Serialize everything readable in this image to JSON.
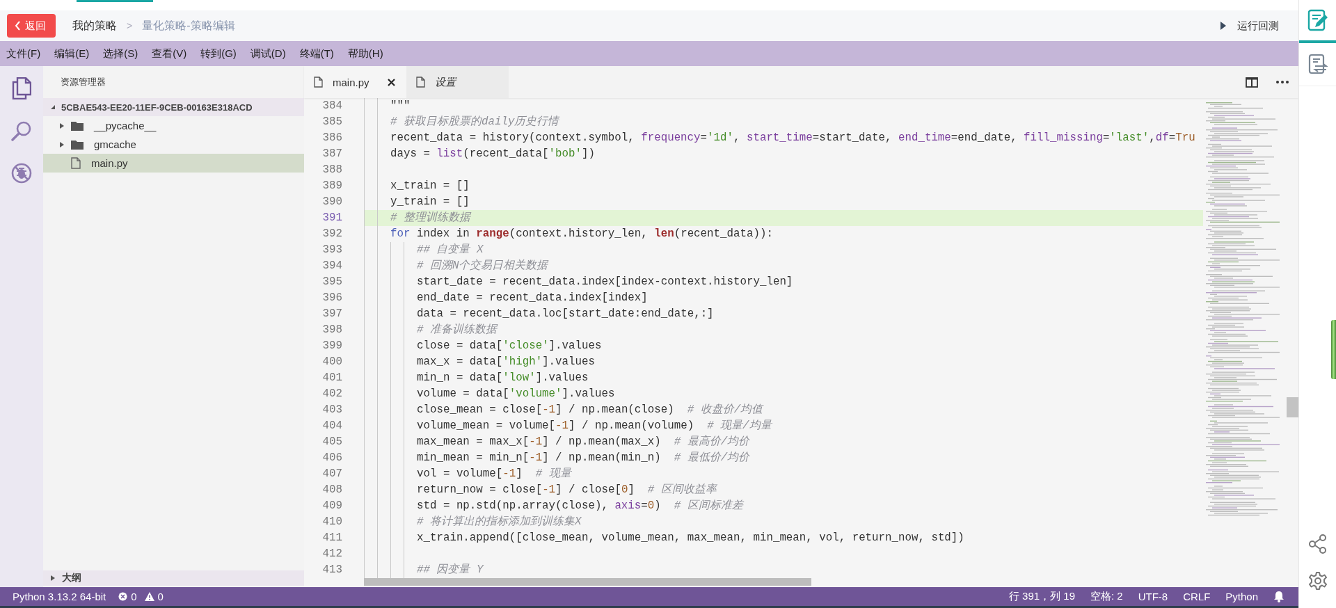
{
  "header": {
    "back_button": "返回",
    "breadcrumb": [
      {
        "label": "我的策略",
        "current": false
      },
      {
        "label": ">",
        "current": false
      },
      {
        "label": "量化策略-策略编辑",
        "current": true
      }
    ],
    "run_button": "运行回测"
  },
  "menu": [
    "文件(F)",
    "编辑(E)",
    "选择(S)",
    "查看(V)",
    "转到(G)",
    "调试(D)",
    "终端(T)",
    "帮助(H)"
  ],
  "explorer": {
    "title": "资源管理器",
    "root": {
      "label": "5CBAE543-EE20-11EF-9CEB-00163E318ACD",
      "expanded": true,
      "children": [
        {
          "label": "__pycache__",
          "kind": "folder",
          "expanded": false,
          "selected": false
        },
        {
          "label": "gmcache",
          "kind": "folder",
          "expanded": false,
          "selected": false
        },
        {
          "label": "main.py",
          "kind": "file",
          "selected": true
        }
      ]
    },
    "outline": {
      "label": "大纲",
      "expanded": false
    }
  },
  "editor": {
    "tabs": [
      {
        "label": "main.py",
        "selected": true,
        "preview": false
      },
      {
        "label": "设置",
        "selected": false,
        "preview": true
      }
    ],
    "lines": [
      {
        "number": "384",
        "current": false,
        "tokens": [
          {
            "kind": "plain",
            "text": "    \"\"\""
          }
        ]
      },
      {
        "number": "385",
        "current": false,
        "tokens": [
          {
            "kind": "comment",
            "text": "    # 获取目标股票的daily历史行情"
          }
        ]
      },
      {
        "number": "386",
        "current": false,
        "tokens": [
          {
            "kind": "plain",
            "text": "    recent_data = history(context.symbol, "
          },
          {
            "kind": "parameter",
            "text": "frequency"
          },
          {
            "kind": "plain",
            "text": "="
          },
          {
            "kind": "string",
            "text": "'1d'"
          },
          {
            "kind": "plain",
            "text": ", "
          },
          {
            "kind": "parameter",
            "text": "start_time"
          },
          {
            "kind": "plain",
            "text": "=start_date, "
          },
          {
            "kind": "parameter",
            "text": "end_time"
          },
          {
            "kind": "plain",
            "text": "=end_date, "
          },
          {
            "kind": "parameter",
            "text": "fill_missing"
          },
          {
            "kind": "plain",
            "text": "="
          },
          {
            "kind": "string",
            "text": "'last'"
          },
          {
            "kind": "plain",
            "text": ","
          },
          {
            "kind": "parameter",
            "text": "df"
          },
          {
            "kind": "plain",
            "text": "="
          },
          {
            "kind": "number",
            "text": "Tru"
          }
        ]
      },
      {
        "number": "387",
        "current": false,
        "tokens": [
          {
            "kind": "plain",
            "text": "    days = "
          },
          {
            "kind": "function",
            "text": "list"
          },
          {
            "kind": "plain",
            "text": "(recent_data["
          },
          {
            "kind": "string",
            "text": "'bob'"
          },
          {
            "kind": "plain",
            "text": "])"
          }
        ]
      },
      {
        "number": "388",
        "current": false
      },
      {
        "number": "389",
        "current": false,
        "tokens": [
          {
            "kind": "plain",
            "text": "    x_train = []"
          }
        ]
      },
      {
        "number": "390",
        "current": false,
        "tokens": [
          {
            "kind": "plain",
            "text": "    y_train = []"
          }
        ]
      },
      {
        "number": "391",
        "current": true,
        "tokens": [
          {
            "kind": "comment",
            "text": "    # 整理训练数据"
          }
        ]
      },
      {
        "number": "392",
        "current": false,
        "tokens": [
          {
            "kind": "keyword",
            "text": "    for"
          },
          {
            "kind": "plain",
            "text": " index in "
          },
          {
            "kind": "builtin",
            "text": "range"
          },
          {
            "kind": "plain",
            "text": "(context.history_len, "
          },
          {
            "kind": "builtin",
            "text": "len"
          },
          {
            "kind": "plain",
            "text": "(recent_data)):"
          }
        ]
      },
      {
        "number": "393",
        "current": false,
        "tokens": [
          {
            "kind": "comment",
            "text": "        ## 自变量 X"
          }
        ]
      },
      {
        "number": "394",
        "current": false,
        "tokens": [
          {
            "kind": "comment",
            "text": "        # 回溯N个交易日相关数据"
          }
        ]
      },
      {
        "number": "395",
        "current": false,
        "tokens": [
          {
            "kind": "plain",
            "text": "        start_date = recent_data.index[index-context.history_len]"
          }
        ]
      },
      {
        "number": "396",
        "current": false,
        "tokens": [
          {
            "kind": "plain",
            "text": "        end_date = recent_data.index[index]"
          }
        ]
      },
      {
        "number": "397",
        "current": false,
        "tokens": [
          {
            "kind": "plain",
            "text": "        data = recent_data.loc[start_date:end_date,:]"
          }
        ]
      },
      {
        "number": "398",
        "current": false,
        "tokens": [
          {
            "kind": "comment",
            "text": "        # 准备训练数据"
          }
        ]
      },
      {
        "number": "399",
        "current": false,
        "tokens": [
          {
            "kind": "plain",
            "text": "        close = data["
          },
          {
            "kind": "string",
            "text": "'close'"
          },
          {
            "kind": "plain",
            "text": "].values"
          }
        ]
      },
      {
        "number": "400",
        "current": false,
        "tokens": [
          {
            "kind": "plain",
            "text": "        max_x = data["
          },
          {
            "kind": "string",
            "text": "'high'"
          },
          {
            "kind": "plain",
            "text": "].values"
          }
        ]
      },
      {
        "number": "401",
        "current": false,
        "tokens": [
          {
            "kind": "plain",
            "text": "        min_n = data["
          },
          {
            "kind": "string",
            "text": "'low'"
          },
          {
            "kind": "plain",
            "text": "].values"
          }
        ]
      },
      {
        "number": "402",
        "current": false,
        "tokens": [
          {
            "kind": "plain",
            "text": "        volume = data["
          },
          {
            "kind": "string",
            "text": "'volume'"
          },
          {
            "kind": "plain",
            "text": "].values"
          }
        ]
      },
      {
        "number": "403",
        "current": false,
        "tokens": [
          {
            "kind": "plain",
            "text": "        close_mean = close["
          },
          {
            "kind": "number",
            "text": "-1"
          },
          {
            "kind": "plain",
            "text": "] / np.mean(close)  "
          },
          {
            "kind": "comment",
            "text": "# 收盘价/均值"
          }
        ]
      },
      {
        "number": "404",
        "current": false,
        "tokens": [
          {
            "kind": "plain",
            "text": "        volume_mean = volume["
          },
          {
            "kind": "number",
            "text": "-1"
          },
          {
            "kind": "plain",
            "text": "] / np.mean(volume)  "
          },
          {
            "kind": "comment",
            "text": "# 现量/均量"
          }
        ]
      },
      {
        "number": "405",
        "current": false,
        "tokens": [
          {
            "kind": "plain",
            "text": "        max_mean = max_x["
          },
          {
            "kind": "number",
            "text": "-1"
          },
          {
            "kind": "plain",
            "text": "] / np.mean(max_x)  "
          },
          {
            "kind": "comment",
            "text": "# 最高价/均价"
          }
        ]
      },
      {
        "number": "406",
        "current": false,
        "tokens": [
          {
            "kind": "plain",
            "text": "        min_mean = min_n["
          },
          {
            "kind": "number",
            "text": "-1"
          },
          {
            "kind": "plain",
            "text": "] / np.mean(min_n)  "
          },
          {
            "kind": "comment",
            "text": "# 最低价/均价"
          }
        ]
      },
      {
        "number": "407",
        "current": false,
        "tokens": [
          {
            "kind": "plain",
            "text": "        vol = volume["
          },
          {
            "kind": "number",
            "text": "-1"
          },
          {
            "kind": "plain",
            "text": "]  "
          },
          {
            "kind": "comment",
            "text": "# 现量"
          }
        ]
      },
      {
        "number": "408",
        "current": false,
        "tokens": [
          {
            "kind": "plain",
            "text": "        return_now = close["
          },
          {
            "kind": "number",
            "text": "-1"
          },
          {
            "kind": "plain",
            "text": "] / close["
          },
          {
            "kind": "number",
            "text": "0"
          },
          {
            "kind": "plain",
            "text": "]  "
          },
          {
            "kind": "comment",
            "text": "# 区间收益率"
          }
        ]
      },
      {
        "number": "409",
        "current": false,
        "tokens": [
          {
            "kind": "plain",
            "text": "        std = np.std(np.array(close), "
          },
          {
            "kind": "parameter",
            "text": "axis"
          },
          {
            "kind": "plain",
            "text": "="
          },
          {
            "kind": "number",
            "text": "0"
          },
          {
            "kind": "plain",
            "text": ")  "
          },
          {
            "kind": "comment",
            "text": "# 区间标准差"
          }
        ]
      },
      {
        "number": "410",
        "current": false,
        "tokens": [
          {
            "kind": "comment",
            "text": "        # 将计算出的指标添加到训练集X"
          }
        ]
      },
      {
        "number": "411",
        "current": false,
        "tokens": [
          {
            "kind": "plain",
            "text": "        x_train.append([close_mean, volume_mean, max_mean, min_mean, vol, return_now, std])"
          }
        ]
      },
      {
        "number": "412",
        "current": false
      },
      {
        "number": "413",
        "current": false,
        "tokens": [
          {
            "kind": "comment",
            "text": "        ## 因变量 Y"
          }
        ]
      }
    ]
  },
  "status_bar": {
    "interpreter": "Python 3.13.2 64-bit",
    "errors": "0",
    "warnings": "0",
    "position": "行 391，列 19",
    "indentation": "空格: 2",
    "encoding": "UTF-8",
    "line_ending": "CRLF",
    "language": "Python"
  },
  "side_panel": {
    "items": [
      {
        "selected": true
      },
      {
        "selected": false
      }
    ]
  }
}
